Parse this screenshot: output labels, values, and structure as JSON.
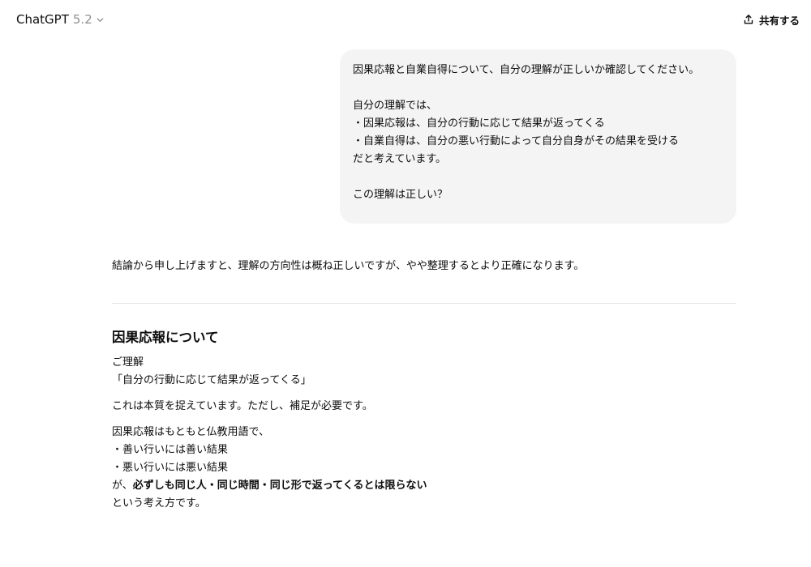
{
  "header": {
    "model_name": "ChatGPT",
    "model_version": "5.2",
    "share_label": "共有する"
  },
  "user_message": {
    "lines": [
      "因果応報と自業自得について、自分の理解が正しいか確認してください。",
      "",
      "自分の理解では、",
      "・因果応報は、自分の行動に応じて結果が返ってくる",
      "・自業自得は、自分の悪い行動によって自分自身がその結果を受ける",
      "だと考えています。",
      "",
      "この理解は正しい？"
    ]
  },
  "assistant_message": {
    "intro": "結論から申し上げますと、理解の方向性は概ね正しいですが、やや整理するとより正確になります。",
    "section_heading": "因果応報について",
    "quote_label": "ご理解",
    "quote_text": "「自分の行動に応じて結果が返ってくる」",
    "comment": "これは本質を捉えています。ただし、補足が必要です。",
    "explanation": {
      "line1": "因果応報はもともと仏教用語で、",
      "line2": "・善い行いには善い結果",
      "line3": "・悪い行いには悪い結果",
      "line4_prefix": "が、",
      "line4_bold": "必ずしも同じ人・同じ時間・同じ形で返ってくるとは限らない",
      "line5": "という考え方です。"
    }
  }
}
